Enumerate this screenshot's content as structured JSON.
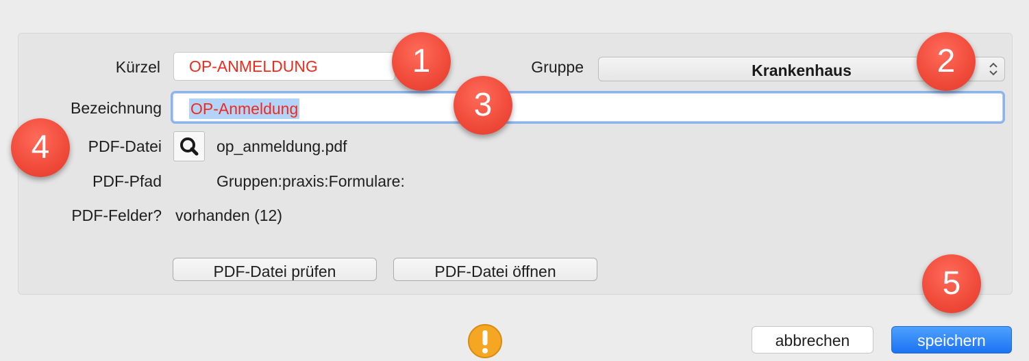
{
  "form": {
    "kuerzel_label": "Kürzel",
    "kuerzel_value": "OP-ANMELDUNG",
    "gruppe_label": "Gruppe",
    "gruppe_value": "Krankenhaus",
    "bezeichnung_label": "Bezeichnung",
    "bezeichnung_value": "OP-Anmeldung",
    "pdf_datei_label": "PDF-Datei",
    "pdf_datei_value": "op_anmeldung.pdf",
    "pdf_pfad_label": "PDF-Pfad",
    "pdf_pfad_value": "Gruppen:praxis:Formulare:",
    "pdf_felder_label": "PDF-Felder?",
    "pdf_felder_value": "vorhanden (12)",
    "pruefen_button": "PDF-Datei prüfen",
    "oeffnen_button": "PDF-Datei öffnen"
  },
  "footer": {
    "cancel_label": "abbrechen",
    "save_label": "speichern"
  },
  "badges": [
    "1",
    "2",
    "3",
    "4",
    "5"
  ],
  "colors": {
    "accent_text": "#ee2a1c",
    "selection": "#b3d4f8",
    "focus_ring": "#8cb4ec",
    "primary_button": "#1c73f2",
    "badge": "#f04a3a",
    "warning": "#f5a623"
  },
  "icons": {
    "search": "magnifier-icon",
    "updown": "updown-chevron-icon",
    "warning": "warning-icon"
  }
}
